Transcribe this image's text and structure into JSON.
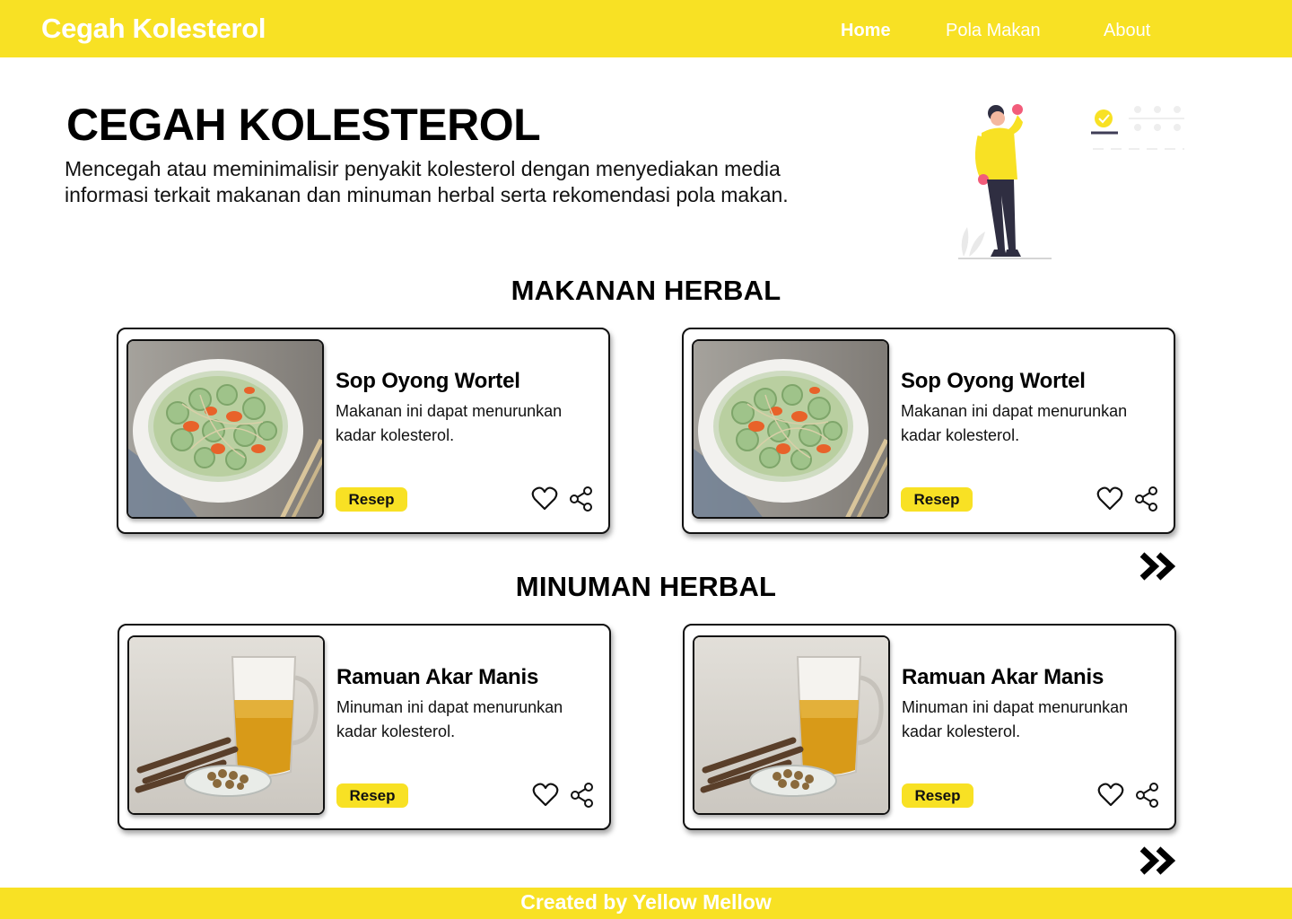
{
  "nav": {
    "brand": "Cegah Kolesterol",
    "links": [
      {
        "label": "Home",
        "active": true
      },
      {
        "label": "Pola Makan",
        "active": false
      },
      {
        "label": "About",
        "active": false
      }
    ]
  },
  "hero": {
    "title": "CEGAH KOLESTEROL",
    "description": "Mencegah atau meminimalisir penyakit kolesterol dengan menyediakan media informasi terkait makanan dan minuman herbal serta rekomendasi pola makan."
  },
  "makanan": {
    "title": "MAKANAN HERBAL",
    "cards": [
      {
        "title": "Sop Oyong Wortel",
        "description": "Makanan ini dapat menurunkan kadar kolesterol.",
        "button": "Resep"
      },
      {
        "title": "Sop Oyong Wortel",
        "description": "Makanan ini dapat menurunkan kadar kolesterol.",
        "button": "Resep"
      }
    ]
  },
  "minuman": {
    "title": "MINUMAN HERBAL",
    "cards": [
      {
        "title": "Ramuan Akar Manis",
        "description": "Minuman ini dapat menurunkan kadar kolesterol.",
        "button": "Resep"
      },
      {
        "title": "Ramuan Akar Manis",
        "description": "Minuman ini dapat menurunkan kadar kolesterol.",
        "button": "Resep"
      }
    ]
  },
  "footer": {
    "text": "Created by Yellow Mellow"
  },
  "icons": {
    "heart": "heart-icon",
    "share": "share-icon",
    "more": "double-chevron-right-icon"
  },
  "colors": {
    "accent": "#f8e124",
    "text": "#000000",
    "background": "#ffffff"
  }
}
